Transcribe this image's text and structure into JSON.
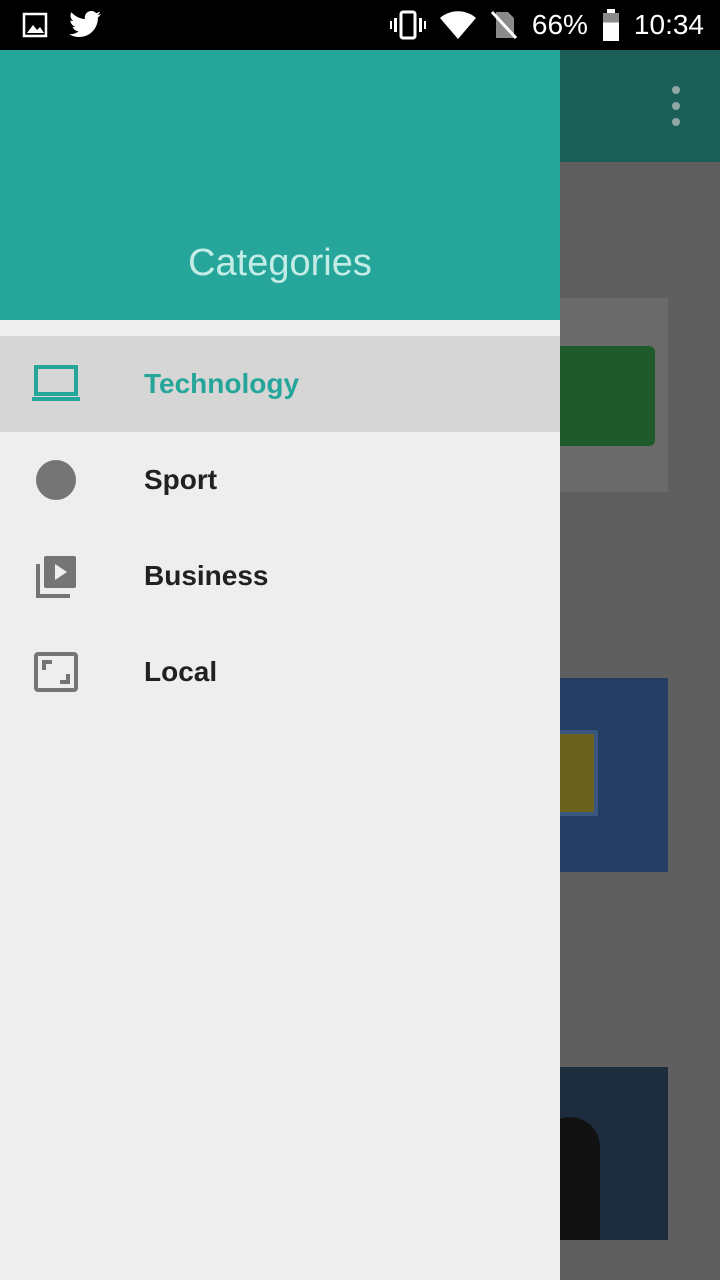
{
  "status_bar": {
    "battery_text": "66%",
    "time": "10:34",
    "battery_level": 0.66,
    "icons": [
      "image-icon",
      "twitter-icon",
      "vibrate-icon",
      "wifi-icon",
      "no-sim-icon",
      "battery-icon"
    ]
  },
  "drawer": {
    "title": "Categories",
    "items": [
      {
        "label": "Technology",
        "icon": "laptop-icon",
        "active": true
      },
      {
        "label": "Sport",
        "icon": "circle-icon",
        "active": false
      },
      {
        "label": "Business",
        "icon": "video-library-icon",
        "active": false
      },
      {
        "label": "Local",
        "icon": "crop-free-icon",
        "active": false
      }
    ]
  },
  "background_app": {
    "overflow_icon": "more-vert-icon"
  },
  "colors": {
    "accent": "#26a69a",
    "drawer_bg": "#eeeeee",
    "active_row": "#d6d6d6",
    "text": "#212121",
    "icon_gray": "#757575"
  }
}
